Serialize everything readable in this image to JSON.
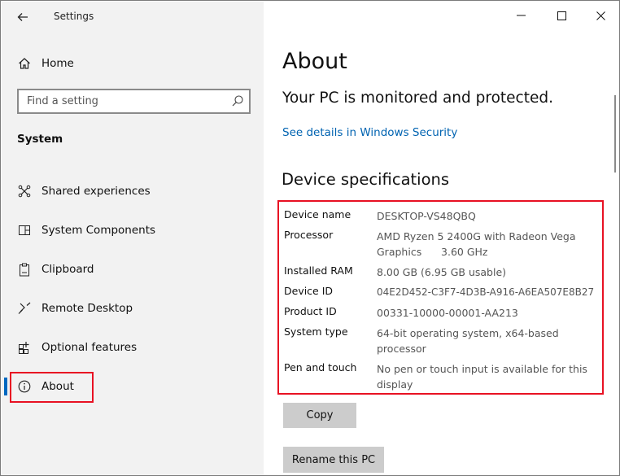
{
  "window": {
    "app_title": "Settings"
  },
  "sidebar": {
    "home_label": "Home",
    "search": {
      "placeholder": "Find a setting"
    },
    "section_label": "System",
    "items": [
      {
        "label": "Shared experiences",
        "icon": "shared-experiences-icon"
      },
      {
        "label": "System Components",
        "icon": "system-components-icon"
      },
      {
        "label": "Clipboard",
        "icon": "clipboard-icon"
      },
      {
        "label": "Remote Desktop",
        "icon": "remote-desktop-icon"
      },
      {
        "label": "Optional features",
        "icon": "optional-features-icon"
      },
      {
        "label": "About",
        "icon": "info-icon",
        "selected": true
      }
    ]
  },
  "main": {
    "title": "About",
    "status": "Your PC is monitored and protected.",
    "security_link": "See details in Windows Security",
    "specs_heading": "Device specifications",
    "specs": [
      {
        "key": "Device name",
        "value": "DESKTOP-VS48QBQ"
      },
      {
        "key": "Processor",
        "value": "AMD Ryzen 5 2400G with Radeon Vega Graphics      3.60 GHz"
      },
      {
        "key": "Installed RAM",
        "value": "8.00 GB (6.95 GB usable)"
      },
      {
        "key": "Device ID",
        "value": "04E2D452-C3F7-4D3B-A916-A6EA507E8B27"
      },
      {
        "key": "Product ID",
        "value": "00331-10000-00001-AA213"
      },
      {
        "key": "System type",
        "value": "64-bit operating system, x64-based processor"
      },
      {
        "key": "Pen and touch",
        "value": "No pen or touch input is available for this display"
      }
    ],
    "copy_button": "Copy",
    "rename_button": "Rename this PC"
  },
  "colors": {
    "accent": "#0067c0",
    "highlight": "#e81123",
    "link": "#0063b1",
    "sidebar_bg": "#f2f2f2"
  }
}
